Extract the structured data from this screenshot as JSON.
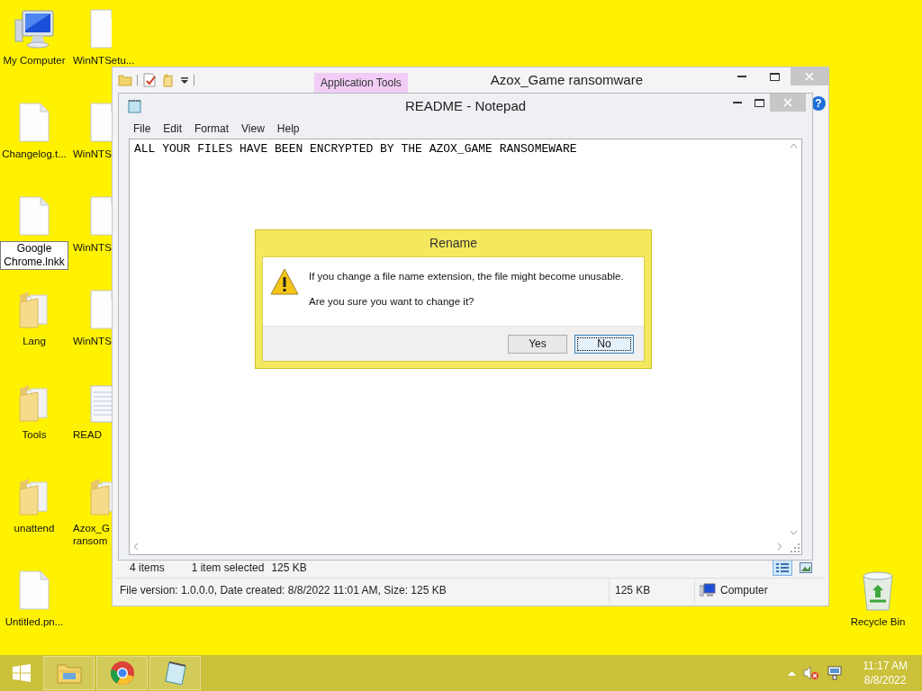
{
  "desktop": {
    "icon_columns": [
      {
        "icons": [
          {
            "kind": "computer",
            "label": "My Computer",
            "renaming": false
          },
          {
            "kind": "file",
            "label": "Changelog.t...",
            "renaming": false
          },
          {
            "kind": "file",
            "label": "Google Chrome.lnkk",
            "renaming": true
          },
          {
            "kind": "folder",
            "label": "Lang",
            "renaming": false
          },
          {
            "kind": "folder",
            "label": "Tools",
            "renaming": false
          },
          {
            "kind": "folder",
            "label": "unattend",
            "renaming": false
          },
          {
            "kind": "file",
            "label": "Untitled.pn...",
            "renaming": false
          }
        ]
      },
      {
        "icons": [
          {
            "kind": "file",
            "label": "WinNTSetu...",
            "renaming": false
          },
          {
            "kind": "file",
            "label": "WinNTS",
            "renaming": false
          },
          {
            "kind": "file",
            "label": "WinNTS",
            "renaming": false
          },
          {
            "kind": "file",
            "label": "WinNTS",
            "renaming": false
          },
          {
            "kind": "text",
            "label": "READ",
            "renaming": false
          },
          {
            "kind": "folder",
            "label": "Azox_G ransom",
            "renaming": false
          }
        ]
      }
    ],
    "recycle_bin": {
      "label": "Recycle Bin"
    }
  },
  "explorer_window": {
    "context_tab": "Application Tools",
    "title": "Azox_Game ransomware",
    "help": "?",
    "status_bar": {
      "items": "4 items",
      "selection": "1 item selected",
      "selection_size": "125 KB"
    },
    "details_bar": {
      "info": "File version: 1.0.0.0, Date created: 8/8/2022 11:01 AM, Size: 125 KB",
      "size": "125 KB",
      "location": "Computer"
    }
  },
  "notepad_window": {
    "title": "README - Notepad",
    "menu": [
      "File",
      "Edit",
      "Format",
      "View",
      "Help"
    ],
    "content": "ALL YOUR FILES HAVE BEEN ENCRYPTED BY THE AZOX_GAME RANSOMEWARE"
  },
  "dialog": {
    "title": "Rename",
    "message": "If you change a file name extension, the file might become unusable.",
    "question": "Are you sure you want to change it?",
    "buttons": [
      {
        "label": "Yes",
        "focused": false
      },
      {
        "label": "No",
        "focused": true
      }
    ]
  },
  "taskbar": {
    "apps": [
      {
        "kind": "explorer"
      },
      {
        "kind": "browser"
      },
      {
        "kind": "notepad"
      }
    ],
    "clock": {
      "time": "11:17 AM",
      "date": "8/8/2022"
    }
  }
}
